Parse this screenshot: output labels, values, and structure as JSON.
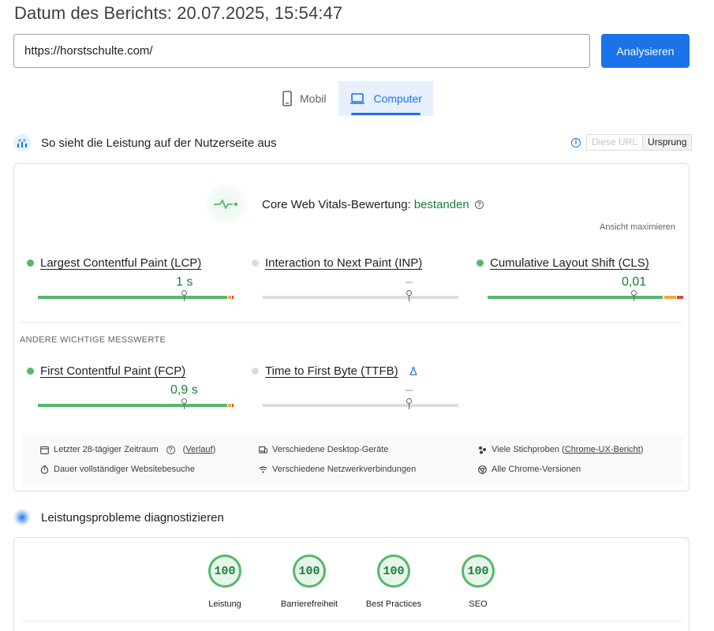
{
  "header": {
    "report_date": "Datum des Berichts: 20.07.2025, 15:54:47"
  },
  "url_bar": {
    "value": "https://horstschulte.com/",
    "button_label": "Analysieren"
  },
  "device_tabs": [
    {
      "label": "Mobil",
      "icon": "smartphone-icon",
      "active": false
    },
    {
      "label": "Computer",
      "icon": "laptop-icon",
      "active": true
    }
  ],
  "field_section": {
    "title": "So sieht die Leistung auf der Nutzerseite aus",
    "toggle": {
      "this_url": "Diese URL",
      "origin": "Ursprung",
      "selected": "Ursprung"
    },
    "cwv": {
      "label": "Core Web Vitals-Bewertung:",
      "status": "bestanden"
    },
    "expand_label": "Ansicht maximieren",
    "metrics": [
      {
        "name": "Largest Contentful Paint (LCP)",
        "value": "1 s",
        "status": "good"
      },
      {
        "name": "Interaction to Next Paint (INP)",
        "value": "–",
        "status": "no-data"
      },
      {
        "name": "Cumulative Layout Shift (CLS)",
        "value": "0,01",
        "status": "good"
      }
    ],
    "other_metrics_label": "ANDERE WICHTIGE MESSWERTE",
    "other_metrics": [
      {
        "name": "First Contentful Paint (FCP)",
        "value": "0,9 s",
        "status": "good"
      },
      {
        "name": "Time to First Byte (TTFB)",
        "value": "–",
        "status": "no-data"
      }
    ],
    "info": {
      "period": "Letzter 28-tägiger Zeitraum",
      "history_link": "Verlauf",
      "devices": "Verschiedene Desktop-Geräte",
      "samples_prefix": "Viele Stichproben (",
      "samples_link": "Chrome-UX-Bericht",
      "samples_suffix": ")",
      "duration": "Dauer vollständiger Websitebesuche",
      "network": "Verschiedene Netzwerkverbindungen",
      "chrome": "Alle Chrome-Versionen"
    }
  },
  "lab_section": {
    "title": "Leistungsprobleme diagnostizieren",
    "scores": [
      {
        "value": "100",
        "label": "Leistung"
      },
      {
        "value": "100",
        "label": "Barrierefreiheit"
      },
      {
        "value": "100",
        "label": "Best Practices"
      },
      {
        "value": "100",
        "label": "SEO"
      }
    ]
  },
  "colors": {
    "accent": "#1a73e8",
    "good": "#55b96b",
    "needs_improvement": "#f4a83a",
    "poor": "#e0433d"
  }
}
